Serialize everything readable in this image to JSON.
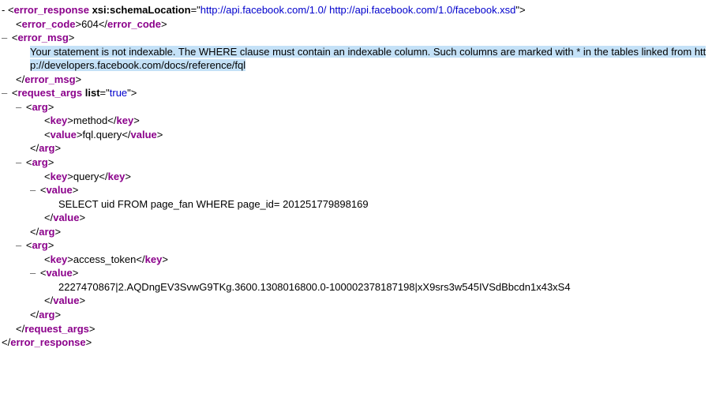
{
  "xml": {
    "root_tag": "error_response",
    "schema_attr_name": "xsi:schemaLocation",
    "schema_attr_value": "http://api.facebook.com/1.0/ http://api.facebook.com/1.0/facebook.xsd",
    "error_code_tag": "error_code",
    "error_code_value": "604",
    "error_msg_tag": "error_msg",
    "error_msg_value": "Your statement is not indexable. The WHERE clause must contain an indexable column. Such columns are marked with * in the tables linked from http://developers.facebook.com/docs/reference/fql",
    "request_args_tag": "request_args",
    "list_attr_name": "list",
    "list_attr_value": "true",
    "arg_tag": "arg",
    "key_tag": "key",
    "value_tag": "value",
    "args": [
      {
        "key": "method",
        "value": "fql.query"
      },
      {
        "key": "query",
        "value": "SELECT uid FROM page_fan WHERE page_id= 201251779898169"
      },
      {
        "key": "access_token",
        "value": "2227470867|2.AQDngEV3SvwG9TKg.3600.1308016800.0-100002378187198|xX9srs3w545IVSdBbcdn1x43xS4"
      }
    ],
    "collapse_dash": "–"
  }
}
